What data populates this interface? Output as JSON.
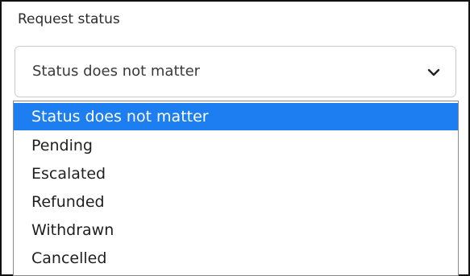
{
  "field": {
    "label": "Request status",
    "selected_value": "Status does not matter"
  },
  "icons": {
    "chevron": "chevron-down-icon"
  },
  "colors": {
    "selected_option_bg": "#1c7ef0",
    "selected_option_text": "#ffffff"
  },
  "options": [
    {
      "label": "Status does not matter",
      "selected": true
    },
    {
      "label": "Pending",
      "selected": false
    },
    {
      "label": "Escalated",
      "selected": false
    },
    {
      "label": "Refunded",
      "selected": false
    },
    {
      "label": "Withdrawn",
      "selected": false
    },
    {
      "label": "Cancelled",
      "selected": false
    }
  ]
}
